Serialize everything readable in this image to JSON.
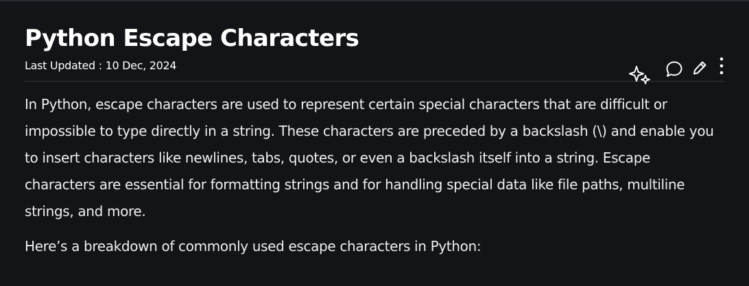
{
  "article": {
    "title": "Python Escape Characters",
    "last_updated": "Last Updated : 10 Dec, 2024",
    "paragraphs": [
      "In Python, escape characters are used to represent certain special characters that are difficult or impossible to type directly in a string. These characters are preceded by a backslash (\\) and enable you to insert characters like newlines, tabs, quotes, or even a backslash itself into a string. Escape characters are essential for formatting strings and for handling special data like file paths, multiline strings, and more.",
      "Here’s a breakdown of commonly used escape characters in Python:"
    ]
  },
  "actions": [
    {
      "name": "ai-sparkle-icon"
    },
    {
      "name": "comment-icon"
    },
    {
      "name": "edit-pencil-icon"
    },
    {
      "name": "more-vertical-icon"
    }
  ],
  "colors": {
    "background": "#131417",
    "text": "#f0f0f0",
    "divider": "#34363c"
  }
}
